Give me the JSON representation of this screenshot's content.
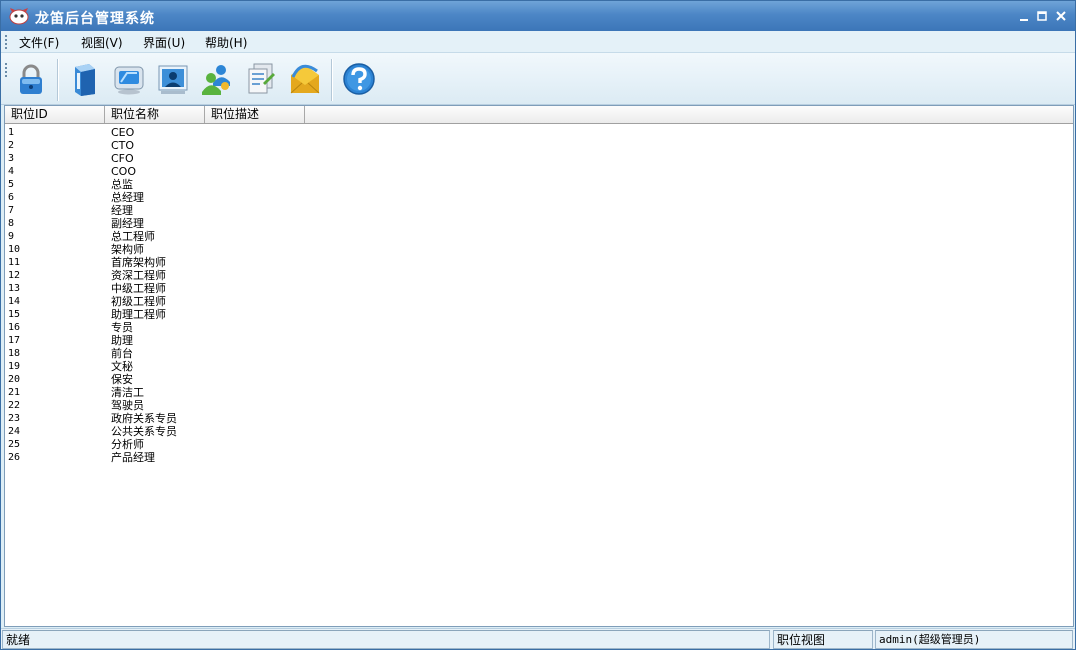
{
  "window": {
    "title": "龙笛后台管理系统"
  },
  "menu": {
    "items": [
      {
        "label": "文件(F)"
      },
      {
        "label": "视图(V)"
      },
      {
        "label": "界面(U)"
      },
      {
        "label": "帮助(H)"
      }
    ]
  },
  "toolbar": {
    "buttons": [
      {
        "icon": "lock-icon"
      },
      {
        "icon": "book-icon"
      },
      {
        "icon": "monitor-icon"
      },
      {
        "icon": "user-card-icon"
      },
      {
        "icon": "users-icon"
      },
      {
        "icon": "documents-icon"
      },
      {
        "icon": "mail-icon"
      },
      {
        "icon": "help-icon"
      }
    ]
  },
  "table": {
    "columns": [
      "职位ID",
      "职位名称",
      "职位描述"
    ],
    "rows": [
      [
        "1",
        "CEO",
        ""
      ],
      [
        "2",
        "CTO",
        ""
      ],
      [
        "3",
        "CFO",
        ""
      ],
      [
        "4",
        "COO",
        ""
      ],
      [
        "5",
        "总监",
        ""
      ],
      [
        "6",
        "总经理",
        ""
      ],
      [
        "7",
        "经理",
        ""
      ],
      [
        "8",
        "副经理",
        ""
      ],
      [
        "9",
        "总工程师",
        ""
      ],
      [
        "10",
        "架构师",
        ""
      ],
      [
        "11",
        "首席架构师",
        ""
      ],
      [
        "12",
        "资深工程师",
        ""
      ],
      [
        "13",
        "中级工程师",
        ""
      ],
      [
        "14",
        "初级工程师",
        ""
      ],
      [
        "15",
        "助理工程师",
        ""
      ],
      [
        "16",
        "专员",
        ""
      ],
      [
        "17",
        "助理",
        ""
      ],
      [
        "18",
        "前台",
        ""
      ],
      [
        "19",
        "文秘",
        ""
      ],
      [
        "20",
        "保安",
        ""
      ],
      [
        "21",
        "清洁工",
        ""
      ],
      [
        "22",
        "驾驶员",
        ""
      ],
      [
        "23",
        "政府关系专员",
        ""
      ],
      [
        "24",
        "公共关系专员",
        ""
      ],
      [
        "25",
        "分析师",
        ""
      ],
      [
        "26",
        "产品经理",
        ""
      ]
    ]
  },
  "status": {
    "message": "就绪",
    "view": "职位视图",
    "user": "admin(超级管理员)"
  },
  "colors": {
    "titlebar": "#4c86c6",
    "accent": "#3c76b8"
  }
}
